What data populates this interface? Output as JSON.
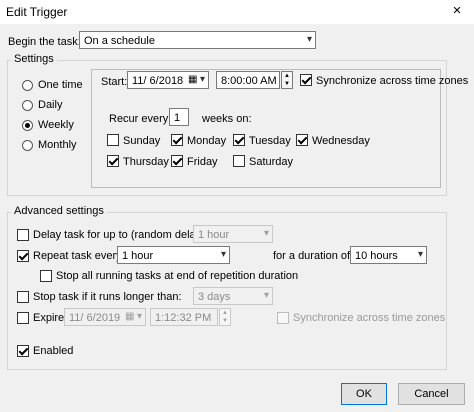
{
  "window": {
    "title": "Edit Trigger",
    "close_icon": "×"
  },
  "begin": {
    "label": "Begin the task:",
    "value": "On a schedule"
  },
  "settings": {
    "legend": "Settings",
    "frequency": [
      {
        "label": "One time",
        "selected": false
      },
      {
        "label": "Daily",
        "selected": false
      },
      {
        "label": "Weekly",
        "selected": true
      },
      {
        "label": "Monthly",
        "selected": false
      }
    ],
    "start_label": "Start:",
    "start_date": "11/ 6/2018",
    "start_time": "8:00:00 AM",
    "sync_label": "Synchronize across time zones",
    "sync_checked": true,
    "recur_label": "Recur every:",
    "recur_value": "1",
    "recur_suffix": "weeks on:",
    "days": [
      {
        "label": "Sunday",
        "checked": false
      },
      {
        "label": "Monday",
        "checked": true
      },
      {
        "label": "Tuesday",
        "checked": true
      },
      {
        "label": "Wednesday",
        "checked": true
      },
      {
        "label": "Thursday",
        "checked": true
      },
      {
        "label": "Friday",
        "checked": true
      },
      {
        "label": "Saturday",
        "checked": false
      }
    ]
  },
  "advanced": {
    "legend": "Advanced settings",
    "delay": {
      "label": "Delay task for up to (random delay):",
      "checked": false,
      "value": "1 hour"
    },
    "repeat": {
      "label": "Repeat task every:",
      "checked": true,
      "value": "1 hour",
      "duration_label": "for a duration of:",
      "duration_value": "10 hours"
    },
    "stop_running": {
      "label": "Stop all running tasks at end of repetition duration",
      "checked": false
    },
    "stop_longer": {
      "label": "Stop task if it runs longer than:",
      "checked": false,
      "value": "3 days"
    },
    "expire": {
      "label": "Expire:",
      "checked": false,
      "date": "11/ 6/2019",
      "time": "1:12:32 PM",
      "sync_label": "Synchronize across time zones"
    },
    "enabled": {
      "label": "Enabled",
      "checked": true
    }
  },
  "buttons": {
    "ok": "OK",
    "cancel": "Cancel"
  },
  "colors": {
    "accent": "#0078d7",
    "background": "#f0f0f0"
  }
}
